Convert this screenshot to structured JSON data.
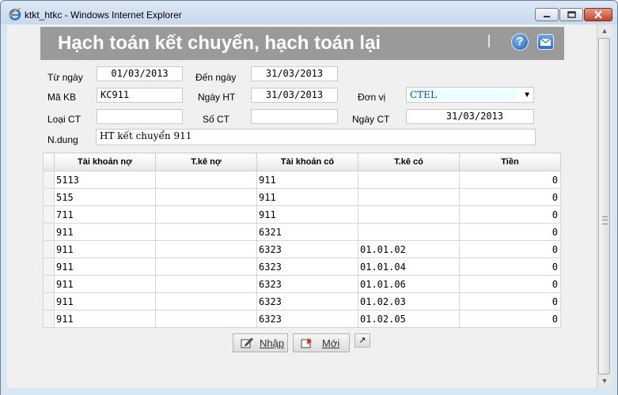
{
  "window": {
    "title": "ktkt_htkc - Windows Internet Explorer",
    "controls": {
      "minimize": "minimize-icon",
      "maximize": "maximize-icon",
      "close": "close-icon"
    }
  },
  "header": {
    "title": "Hạch toán kết chuyển, hạch toán lại",
    "help_icon_glyph": "?",
    "colors": {
      "banner": "#9a9a9a",
      "title": "#ffffff"
    }
  },
  "form": {
    "tu_ngay": {
      "label": "Từ ngày",
      "value": "01/03/2013"
    },
    "den_ngay": {
      "label": "Đến ngày",
      "value": "31/03/2013"
    },
    "ma_kb": {
      "label": "Mã KB",
      "value": "KC911"
    },
    "ngay_ht": {
      "label": "Ngày HT",
      "value": "31/03/2013"
    },
    "don_vi": {
      "label": "Đơn vị",
      "value": "CTEL"
    },
    "loai_ct": {
      "label": "Loại CT",
      "value": ""
    },
    "so_ct": {
      "label": "Số CT",
      "value": ""
    },
    "ngay_ct": {
      "label": "Ngày CT",
      "value": "31/03/2013"
    },
    "n_dung": {
      "label": "N.dung",
      "value": "HT kết chuyển 911"
    }
  },
  "table": {
    "headers": [
      "Tài khoản nợ",
      "T.kê nợ",
      "Tài khoản có",
      "T.kê có",
      "Tiền"
    ],
    "rows": [
      [
        "5113",
        "",
        "911",
        "",
        "0"
      ],
      [
        "515",
        "",
        "911",
        "",
        "0"
      ],
      [
        "711",
        "",
        "911",
        "",
        "0"
      ],
      [
        "911",
        "",
        "6321",
        "",
        "0"
      ],
      [
        "911",
        "",
        "6323",
        "01.01.02",
        "0"
      ],
      [
        "911",
        "",
        "6323",
        "01.01.04",
        "0"
      ],
      [
        "911",
        "",
        "6323",
        "01.01.06",
        "0"
      ],
      [
        "911",
        "",
        "6323",
        "01.02.03",
        "0"
      ],
      [
        "911",
        "",
        "6323",
        "01.02.05",
        "0"
      ]
    ]
  },
  "buttons": {
    "nhap": {
      "label": "Nhập",
      "icon": "edit-icon"
    },
    "moi": {
      "label": "Mới",
      "icon": "new-document-icon"
    },
    "extra": {
      "glyph": "↗",
      "icon": "chart-arrow-icon"
    }
  }
}
